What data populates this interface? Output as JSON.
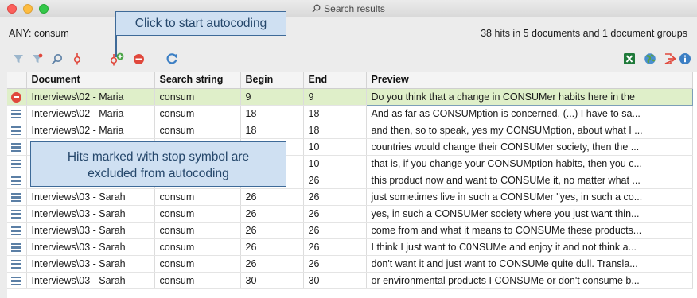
{
  "window": {
    "title": "Search results"
  },
  "info": {
    "query": "ANY: consum",
    "stats": "38 hits in 5 documents and 1 document groups"
  },
  "toolbar": {
    "left_icons": [
      "filter-icon",
      "filter-reset-icon",
      "search-icon",
      "code-icon",
      "autocode-icon",
      "stop-icon",
      "refresh-icon"
    ],
    "right_icons": [
      "excel-export-icon",
      "web-export-icon",
      "export-icon",
      "info-icon"
    ]
  },
  "table": {
    "columns": [
      "",
      "Document",
      "Search string",
      "Begin",
      "End",
      "Preview"
    ],
    "rows": [
      {
        "status": "stop",
        "document": "Interviews\\02 - Maria",
        "search": "consum",
        "begin": "9",
        "end": "9",
        "preview": "Do you think that a change in CONSUMer habits here in the"
      },
      {
        "status": "include",
        "document": "Interviews\\02 - Maria",
        "search": "consum",
        "begin": "18",
        "end": "18",
        "preview": "And as far as CONSUMption is concerned, (...) I have to sa..."
      },
      {
        "status": "include",
        "document": "Interviews\\02 - Maria",
        "search": "consum",
        "begin": "18",
        "end": "18",
        "preview": "and then, so to speak, yes my CONSUMption, about what I ..."
      },
      {
        "status": "include",
        "document": "",
        "search": "",
        "begin": "",
        "end": "10",
        "preview": "countries would change their CONSUMer society, then the ..."
      },
      {
        "status": "include",
        "document": "",
        "search": "",
        "begin": "",
        "end": "10",
        "preview": "that is, if you change your CONSUMption habits, then you c..."
      },
      {
        "status": "include",
        "document": "",
        "search": "",
        "begin": "",
        "end": "26",
        "preview": "this product now and want to CONSUMe it, no matter what ..."
      },
      {
        "status": "include",
        "document": "Interviews\\03 - Sarah",
        "search": "consum",
        "begin": "26",
        "end": "26",
        "preview": "just sometimes live in such a CONSUMer \"yes, in such a co..."
      },
      {
        "status": "include",
        "document": "Interviews\\03 - Sarah",
        "search": "consum",
        "begin": "26",
        "end": "26",
        "preview": "yes, in such a CONSUMer society where you just want thin..."
      },
      {
        "status": "include",
        "document": "Interviews\\03 - Sarah",
        "search": "consum",
        "begin": "26",
        "end": "26",
        "preview": "come from and what it means to CONSUMe these products..."
      },
      {
        "status": "include",
        "document": "Interviews\\03 - Sarah",
        "search": "consum",
        "begin": "26",
        "end": "26",
        "preview": "I think I just want to C0NSUMe and enjoy it and not think a..."
      },
      {
        "status": "include",
        "document": "Interviews\\03 - Sarah",
        "search": "consum",
        "begin": "26",
        "end": "26",
        "preview": "don't want it and just want to CONSUMe quite dull.  Transla..."
      },
      {
        "status": "include",
        "document": "Interviews\\03 - Sarah",
        "search": "consum",
        "begin": "30",
        "end": "30",
        "preview": "or environmental products I CONSUMe or don't consume b..."
      }
    ]
  },
  "callouts": {
    "autocode": "Click to start autocoding",
    "stop_line1": "Hits marked with stop symbol are",
    "stop_line2": "excluded from autocoding"
  },
  "colors": {
    "selected_row": "#dfefc9",
    "callout_bg": "#cfe0f2",
    "callout_border": "#3e6a98",
    "stop_red": "#e0483c",
    "include_blue": "#5b7fa5"
  }
}
